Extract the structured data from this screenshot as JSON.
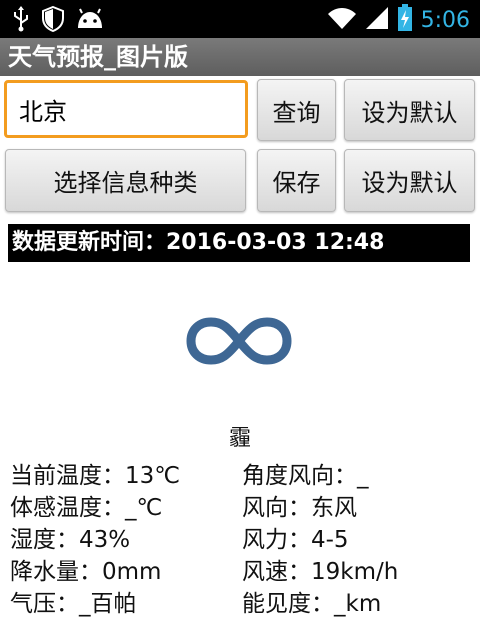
{
  "status_bar": {
    "time": "5:06",
    "icons": [
      "usb-icon",
      "shield-icon",
      "android-icon",
      "wifi-icon",
      "signal-icon",
      "battery-icon"
    ]
  },
  "app": {
    "title": "天气预报_图片版"
  },
  "search": {
    "city_value": "北京"
  },
  "buttons": {
    "query": "查询",
    "set_default_1": "设为默认",
    "select_info": "选择信息种类",
    "save": "保存",
    "set_default_2": "设为默认"
  },
  "update": {
    "label": "数据更新时间：2016-03-03 12:48"
  },
  "weather": {
    "icon": "haze-icon",
    "condition": "霾",
    "details": [
      {
        "left": "当前温度：13℃",
        "right": "角度风向：_"
      },
      {
        "left": "体感温度：_℃",
        "right": "风向：东风"
      },
      {
        "left": "湿度：43%",
        "right": "风力：4-5"
      },
      {
        "left": "降水量：0mm",
        "right": "风速：19km/h"
      },
      {
        "left": "气压：_百帕",
        "right": "能见度：_km"
      }
    ]
  },
  "colors": {
    "accent_time": "#33b5e5",
    "input_focus": "#f39c1f",
    "haze_icon": "#3e6794"
  }
}
